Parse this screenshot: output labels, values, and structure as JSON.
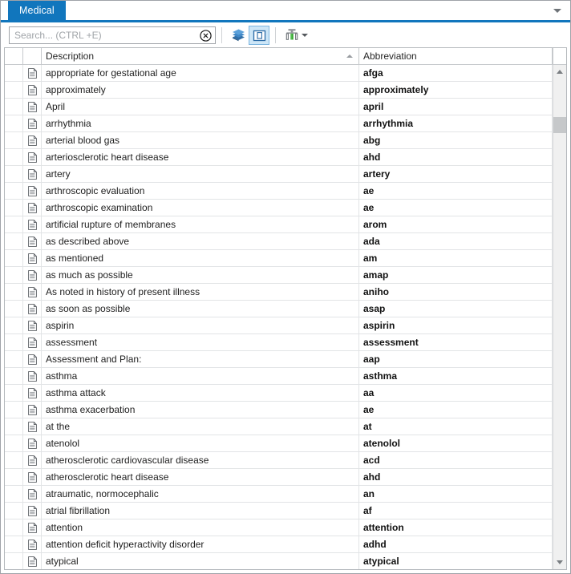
{
  "window": {
    "tab_label": "Medical",
    "tabstrip_overflow_icon": "chevron-down-icon",
    "accent_color": "#1176bd"
  },
  "toolbar": {
    "search_placeholder": "Search... (CTRL +E)",
    "search_value": "",
    "clear_icon": "clear-circle-icon",
    "buttons": [
      {
        "name": "stack-icon",
        "title": "All Lists",
        "active": false
      },
      {
        "name": "folder-document-icon",
        "title": "Current List",
        "active": true
      },
      {
        "name": "column-chart-filter-icon",
        "title": "Filter",
        "active": false,
        "has_caret": true
      }
    ]
  },
  "grid": {
    "columns": [
      {
        "key": "sel",
        "label": ""
      },
      {
        "key": "icon",
        "label": ""
      },
      {
        "key": "description",
        "label": "Description",
        "sorted": "asc"
      },
      {
        "key": "abbreviation",
        "label": "Abbreviation",
        "sorted": "none"
      }
    ],
    "row_icon": "document-icon",
    "rows": [
      {
        "description": "appropriate for gestational age",
        "abbreviation": "afga"
      },
      {
        "description": "approximately",
        "abbreviation": "approximately"
      },
      {
        "description": "April",
        "abbreviation": "april"
      },
      {
        "description": "arrhythmia",
        "abbreviation": "arrhythmia"
      },
      {
        "description": "arterial blood gas",
        "abbreviation": "abg"
      },
      {
        "description": "arteriosclerotic heart disease",
        "abbreviation": "ahd"
      },
      {
        "description": "artery",
        "abbreviation": "artery"
      },
      {
        "description": "arthroscopic evaluation",
        "abbreviation": "ae"
      },
      {
        "description": "arthroscopic examination",
        "abbreviation": "ae"
      },
      {
        "description": "artificial rupture of membranes",
        "abbreviation": "arom"
      },
      {
        "description": "as described above",
        "abbreviation": "ada"
      },
      {
        "description": "as mentioned",
        "abbreviation": "am"
      },
      {
        "description": "as much as possible",
        "abbreviation": "amap"
      },
      {
        "description": "As noted in history of present illness",
        "abbreviation": "aniho"
      },
      {
        "description": "as soon as possible",
        "abbreviation": "asap"
      },
      {
        "description": "aspirin",
        "abbreviation": "aspirin"
      },
      {
        "description": "assessment",
        "abbreviation": "assessment"
      },
      {
        "description": "Assessment and Plan:",
        "abbreviation": "aap"
      },
      {
        "description": "asthma",
        "abbreviation": "asthma"
      },
      {
        "description": "asthma attack",
        "abbreviation": "aa"
      },
      {
        "description": "asthma exacerbation",
        "abbreviation": "ae"
      },
      {
        "description": "at the",
        "abbreviation": "at"
      },
      {
        "description": "atenolol",
        "abbreviation": "atenolol"
      },
      {
        "description": "atherosclerotic cardiovascular disease",
        "abbreviation": "acd"
      },
      {
        "description": "atherosclerotic heart disease",
        "abbreviation": "ahd"
      },
      {
        "description": "atraumatic, normocephalic",
        "abbreviation": "an"
      },
      {
        "description": "atrial fibrillation",
        "abbreviation": "af"
      },
      {
        "description": "attention",
        "abbreviation": "attention"
      },
      {
        "description": "attention deficit hyperactivity disorder",
        "abbreviation": "adhd"
      },
      {
        "description": "atypical",
        "abbreviation": "atypical"
      }
    ]
  },
  "scrollbar": {
    "up_icon": "scroll-up-arrow-icon",
    "down_icon": "scroll-down-arrow-icon",
    "thumb_name": "scrollbar-thumb"
  }
}
